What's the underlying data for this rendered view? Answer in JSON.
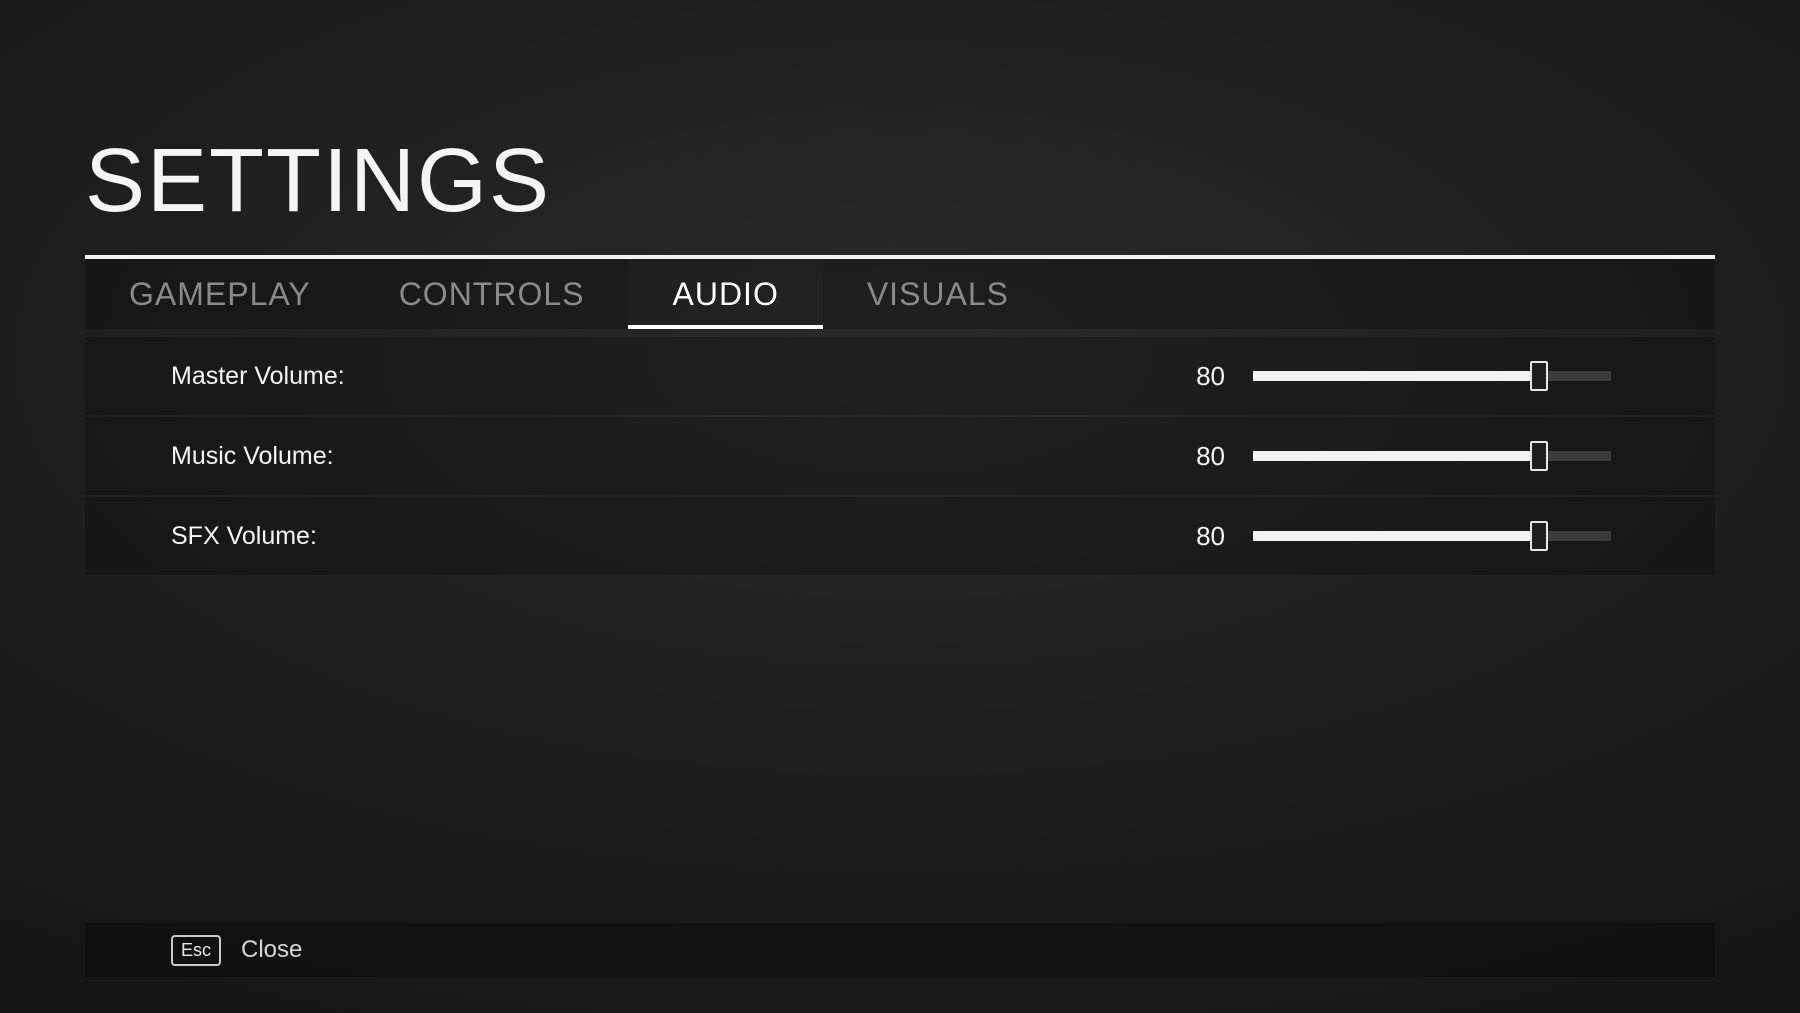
{
  "title": "SETTINGS",
  "tabs": [
    {
      "label": "GAMEPLAY",
      "active": false
    },
    {
      "label": "CONTROLS",
      "active": false
    },
    {
      "label": "AUDIO",
      "active": true
    },
    {
      "label": "VISUALS",
      "active": false
    }
  ],
  "settings": [
    {
      "label": "Master Volume:",
      "value": 80,
      "max": 100
    },
    {
      "label": "Music Volume:",
      "value": 80,
      "max": 100
    },
    {
      "label": "SFX Volume:",
      "value": 80,
      "max": 100
    }
  ],
  "footer": {
    "key": "Esc",
    "label": "Close"
  }
}
